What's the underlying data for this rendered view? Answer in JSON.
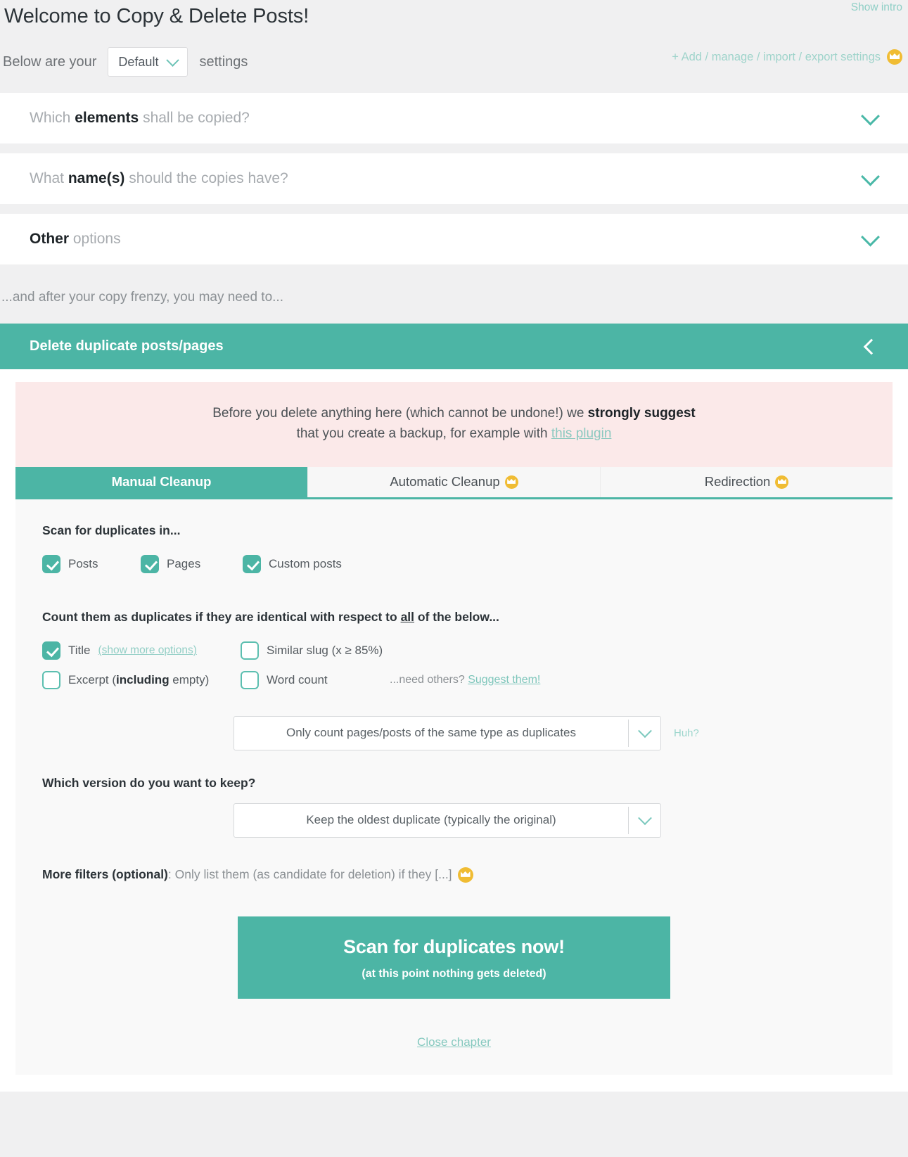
{
  "intro": {
    "title": "Welcome to Copy & Delete Posts!",
    "show_intro": "Show intro",
    "lead": "Below are your",
    "preset_value": "Default",
    "trail": "settings",
    "manage_link": "+ Add / manage / import / export settings"
  },
  "accordions": [
    {
      "pre": "Which ",
      "bold": "elements",
      "post": " shall be copied?"
    },
    {
      "pre": "What ",
      "bold": "name(s)",
      "post": " should the copies have?"
    },
    {
      "pre": "",
      "bold": "Other",
      "post": " options"
    }
  ],
  "after_line": "...and after your copy frenzy, you may need to...",
  "chapter": {
    "title": "Delete duplicate posts/pages",
    "warning": {
      "line1_a": "Before you delete anything here (which cannot be undone!) we ",
      "line1_b": "strongly suggest",
      "line2_a": "that you create a backup, for example with ",
      "line2_link": "this plugin"
    },
    "tabs": [
      {
        "label": "Manual Cleanup",
        "active": true,
        "premium": false
      },
      {
        "label": "Automatic Cleanup",
        "active": false,
        "premium": true
      },
      {
        "label": "Redirection",
        "active": false,
        "premium": true
      }
    ],
    "scan_in": {
      "heading": "Scan for duplicates in...",
      "options": [
        {
          "label": "Posts",
          "checked": true
        },
        {
          "label": "Pages",
          "checked": true
        },
        {
          "label": "Custom posts",
          "checked": true
        }
      ]
    },
    "criteria": {
      "heading_a": "Count them as duplicates if they are identical with respect to ",
      "heading_u": "all",
      "heading_b": " of the below...",
      "title": {
        "label": "Title",
        "sub": "(show more options)",
        "checked": true
      },
      "similar_slug": {
        "label": "Similar slug (x ≥ 85%)",
        "checked": false
      },
      "excerpt": {
        "label_a": "Excerpt (",
        "label_b": "including",
        "label_c": " empty)",
        "checked": false
      },
      "word_count": {
        "label": "Word count",
        "checked": false
      },
      "need_others_text": "...need others? ",
      "need_others_link": "Suggest them!"
    },
    "type_select": {
      "value": "Only count pages/posts of the same type as duplicates",
      "help": "Huh?"
    },
    "keep": {
      "heading": "Which version do you want to keep?",
      "value": "Keep the oldest duplicate (typically the original)"
    },
    "more_filters": {
      "bold": "More filters (optional)",
      "rest": ": Only list them (as candidate for deletion) if they [...]"
    },
    "cta": {
      "big": "Scan for duplicates now!",
      "small": "(at this point nothing gets deleted)"
    },
    "close_chapter": "Close chapter"
  }
}
